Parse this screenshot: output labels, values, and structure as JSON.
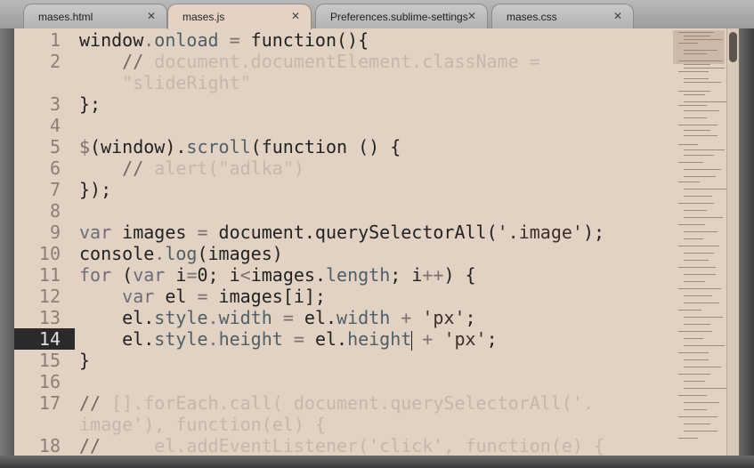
{
  "tabs": [
    {
      "label": "mases.html",
      "close": "✕",
      "active": false
    },
    {
      "label": "mases.js",
      "close": "✕",
      "active": true
    },
    {
      "label": "Preferences.sublime-settings",
      "close": "✕",
      "active": false
    },
    {
      "label": "mases.css",
      "close": "✕",
      "active": false
    }
  ],
  "editor": {
    "current_line": 14,
    "line_numbers": [
      "1",
      "2",
      "3",
      "4",
      "5",
      "6",
      "7",
      "8",
      "9",
      "10",
      "11",
      "12",
      "13",
      "14",
      "15",
      "16",
      "17",
      "18"
    ],
    "code": {
      "l1a": "window",
      "l1b": ".",
      "l1c": "onload",
      "l1d": " = ",
      "l1e": "function(){",
      "l2a": "    // ",
      "l2b": "document.documentElement.className =",
      "l2c": "    \"slideRight\"",
      "l3": "};",
      "l5a": "$",
      "l5b": "(window).",
      "l5c": "scroll",
      "l5d": "(function () {",
      "l6a": "    // ",
      "l6b": "alert(\"adlka\")",
      "l7": "});",
      "l9a": "var",
      "l9b": " images ",
      "l9c": "=",
      "l9d": " document.querySelectorAll(",
      "l9e": "'.image'",
      "l9f": ");",
      "l10a": "console",
      "l10b": ".",
      "l10c": "log",
      "l10d": "(images)",
      "l11a": "for",
      "l11b": " (",
      "l11c": "var",
      "l11d": " i",
      "l11e": "=",
      "l11f": "0; i",
      "l11g": "<",
      "l11h": "images.",
      "l11i": "length",
      "l11j": "; i",
      "l11k": "++",
      "l11l": ") {",
      "l12a": "    ",
      "l12b": "var",
      "l12c": " el ",
      "l12d": "=",
      "l12e": " images[i];",
      "l13a": "    el.",
      "l13b": "style",
      "l13c": ".",
      "l13d": "width",
      "l13e": " = ",
      "l13f": "el.",
      "l13g": "width",
      "l13h": " + ",
      "l13i": "'px'",
      "l13j": ";",
      "l14a": "    el.",
      "l14b": "style",
      "l14c": ".",
      "l14d": "height",
      "l14e": " = ",
      "l14f": "el.",
      "l14g": "height",
      "l14h": " + ",
      "l14i": "'px'",
      "l14j": ";",
      "l15": "}",
      "l17a": "// ",
      "l17b": "[].forEach.call( document.querySelectorAll('.",
      "l17c": "image'), function(el) {",
      "l18a": "//",
      "l18b": "     el.addEventListener('click', function(e) {"
    }
  },
  "colors": {
    "editor_bg": "#e2d2c4",
    "current_line_gutter": "#2a2a2a",
    "comment": "#c6b7ab"
  }
}
